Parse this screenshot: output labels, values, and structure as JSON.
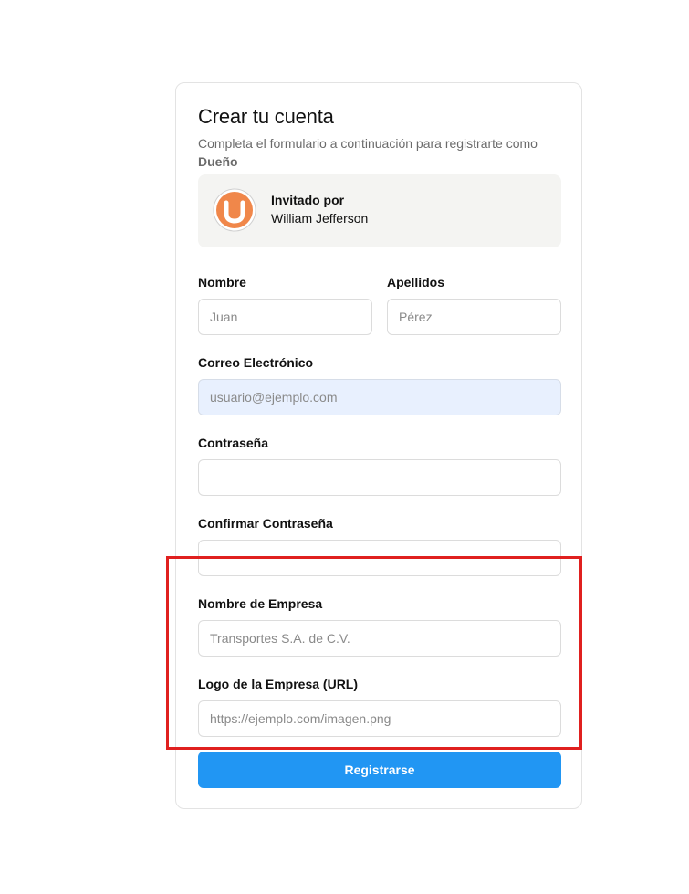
{
  "form": {
    "title": "Crear tu cuenta",
    "subtitle": "Completa el formulario a continuación para registrarte como",
    "role": "Dueño",
    "invite": {
      "label": "Invitado por",
      "name": "William Jefferson",
      "avatar_icon": "orange-u-logo-icon",
      "avatar_color": "#f0874a"
    },
    "fields": {
      "first_name": {
        "label": "Nombre",
        "placeholder": "Juan",
        "value": ""
      },
      "last_name": {
        "label": "Apellidos",
        "placeholder": "Pérez",
        "value": ""
      },
      "email": {
        "label": "Correo Electrónico",
        "placeholder": "usuario@ejemplo.com",
        "value": ""
      },
      "password": {
        "label": "Contraseña",
        "placeholder": "",
        "value": ""
      },
      "confirm_password": {
        "label": "Confirmar Contraseña",
        "placeholder": "",
        "value": ""
      },
      "company_name": {
        "label": "Nombre de Empresa",
        "placeholder": "Transportes S.A. de C.V.",
        "value": ""
      },
      "company_logo": {
        "label": "Logo de la Empresa (URL)",
        "placeholder": "https://ejemplo.com/imagen.png",
        "value": ""
      }
    },
    "submit_label": "Registrarse"
  },
  "colors": {
    "accent": "#2196f3",
    "highlight": "#e0201f",
    "autofill_bg": "#e8f0fe",
    "invite_bg": "#f4f4f2"
  }
}
